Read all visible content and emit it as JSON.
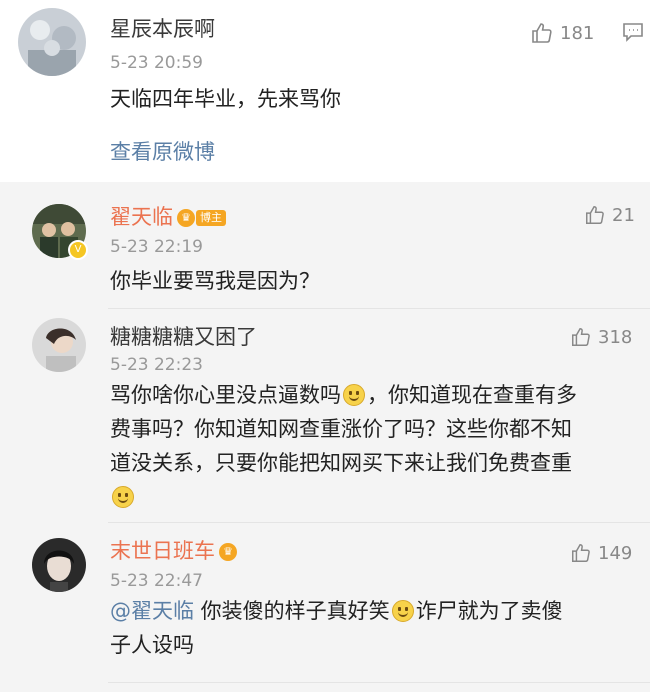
{
  "post": {
    "author": "星辰本辰啊",
    "time": "5-23 20:59",
    "likes": "181",
    "text": "天临四年毕业，先来骂你",
    "view_original": "查看原微博"
  },
  "replies": [
    {
      "author": "翟天临",
      "badge": "博主",
      "time": "5-23 22:19",
      "likes": "21",
      "text": "你毕业要骂我是因为？"
    },
    {
      "author": "糖糖糖糖又困了",
      "time": "5-23 22:23",
      "likes": "318",
      "lines": [
        "骂你啥你心里没点逼数吗",
        "，你知道现在查重有多",
        "费事吗？你知道知网查重涨价了吗？这些你都不知",
        "道没关系，只要你能把知网买下来让我们免费查重"
      ]
    },
    {
      "author": "末世日班车",
      "time": "5-23 22:47",
      "likes": "149",
      "mention": "@翟天临",
      "line1": " 你装傻的样子真好笑",
      "line1b": "诈尸就为了卖傻",
      "line2": "子人设吗"
    }
  ],
  "icons": [
    "thumb-up-icon",
    "comment-icon",
    "emoji-smile-icon",
    "vip-crown-icon"
  ],
  "colors": {
    "accent_orange": "#eb7350",
    "link_blue": "#5b7fa6",
    "reply_bg": "#f4f4f4"
  }
}
